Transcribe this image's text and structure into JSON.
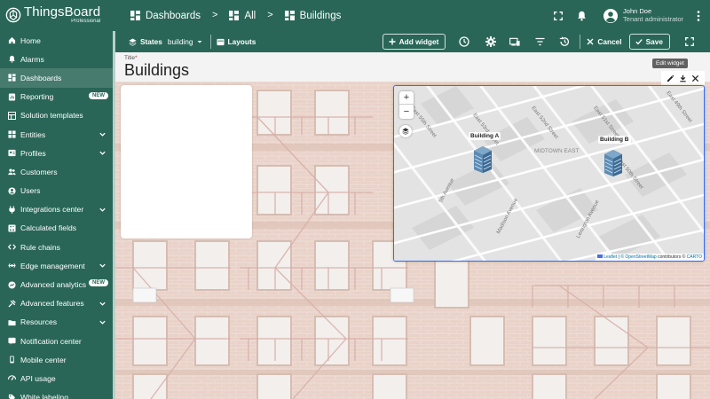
{
  "logo": {
    "title": "ThingsBoard",
    "subtitle": "Professional"
  },
  "breadcrumb": {
    "items": [
      "Dashboards",
      "All",
      "Buildings"
    ],
    "separator": ">"
  },
  "user": {
    "name": "John Doe",
    "role": "Tenant administrator"
  },
  "sidebar": {
    "items": [
      {
        "label": "Home",
        "icon": "home-icon"
      },
      {
        "label": "Alarms",
        "icon": "alarm-icon"
      },
      {
        "label": "Dashboards",
        "icon": "dashboards-icon",
        "active": true
      },
      {
        "label": "Reporting",
        "icon": "reporting-icon",
        "badge": "NEW"
      },
      {
        "label": "Solution templates",
        "icon": "templates-icon"
      },
      {
        "label": "Entities",
        "icon": "entities-icon",
        "expandable": true
      },
      {
        "label": "Profiles",
        "icon": "profiles-icon",
        "expandable": true
      },
      {
        "label": "Customers",
        "icon": "customers-icon"
      },
      {
        "label": "Users",
        "icon": "users-icon"
      },
      {
        "label": "Integrations center",
        "icon": "integrations-icon",
        "expandable": true
      },
      {
        "label": "Calculated fields",
        "icon": "calculated-icon"
      },
      {
        "label": "Rule chains",
        "icon": "rule-chains-icon"
      },
      {
        "label": "Edge management",
        "icon": "edge-icon",
        "expandable": true
      },
      {
        "label": "Advanced analytics",
        "icon": "analytics-icon",
        "badge": "NEW"
      },
      {
        "label": "Advanced features",
        "icon": "features-icon",
        "expandable": true
      },
      {
        "label": "Resources",
        "icon": "resources-icon",
        "expandable": true
      },
      {
        "label": "Notification center",
        "icon": "notification-icon"
      },
      {
        "label": "Mobile center",
        "icon": "mobile-icon"
      },
      {
        "label": "API usage",
        "icon": "api-icon"
      },
      {
        "label": "White labeling",
        "icon": "white-label-icon"
      }
    ]
  },
  "toolbar": {
    "states_label": "States",
    "states_value": "building",
    "layouts_label": "Layouts",
    "add_widget_label": "Add widget",
    "cancel_label": "Cancel",
    "save_label": "Save"
  },
  "title_field": {
    "label": "Title",
    "required_mark": "*",
    "value": "Buildings"
  },
  "widget_actions": {
    "tooltip": "Edit widget"
  },
  "map": {
    "markers": [
      {
        "label": "Building A"
      },
      {
        "label": "Building B"
      }
    ],
    "district": "MIDTOWN EAST",
    "streets": [
      "East 55th Street",
      "East 53rd Street",
      "East 52nd Street",
      "East 51st Street",
      "East 50th Street",
      "East 49th Street",
      "East 54th Street",
      "5th Avenue",
      "Madison Avenue",
      "Lexington Avenue",
      "Park Avenue"
    ],
    "attribution": {
      "leaflet": "Leaflet",
      "osm": "© OpenStreetMap",
      "contrib": "contributors ©",
      "carto": "CARTO"
    }
  },
  "colors": {
    "primary": "#296657",
    "accent": "#2f6cff"
  }
}
